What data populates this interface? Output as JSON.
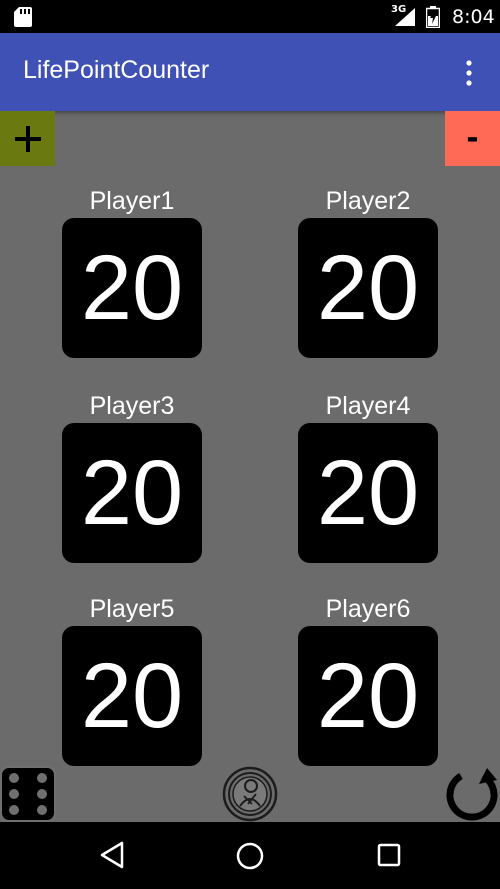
{
  "status_bar": {
    "network": "3G",
    "time": "8:04"
  },
  "app_bar": {
    "title": "LifePointCounter"
  },
  "controls": {
    "increment_label": "+",
    "decrement_label": "-"
  },
  "players": [
    {
      "name": "Player1",
      "life": "20"
    },
    {
      "name": "Player2",
      "life": "20"
    },
    {
      "name": "Player3",
      "life": "20"
    },
    {
      "name": "Player4",
      "life": "20"
    },
    {
      "name": "Player5",
      "life": "20"
    },
    {
      "name": "Player6",
      "life": "20"
    }
  ],
  "icons": {
    "dice": "dice-icon",
    "planeswalker": "planeswalker-icon",
    "reset": "reset-icon",
    "overflow": "more-vert-icon"
  },
  "colors": {
    "background": "#6b6b6b",
    "app_bar": "#3f51b5",
    "plus_button": "#6b7a10",
    "minus_button": "#ff6a57"
  }
}
